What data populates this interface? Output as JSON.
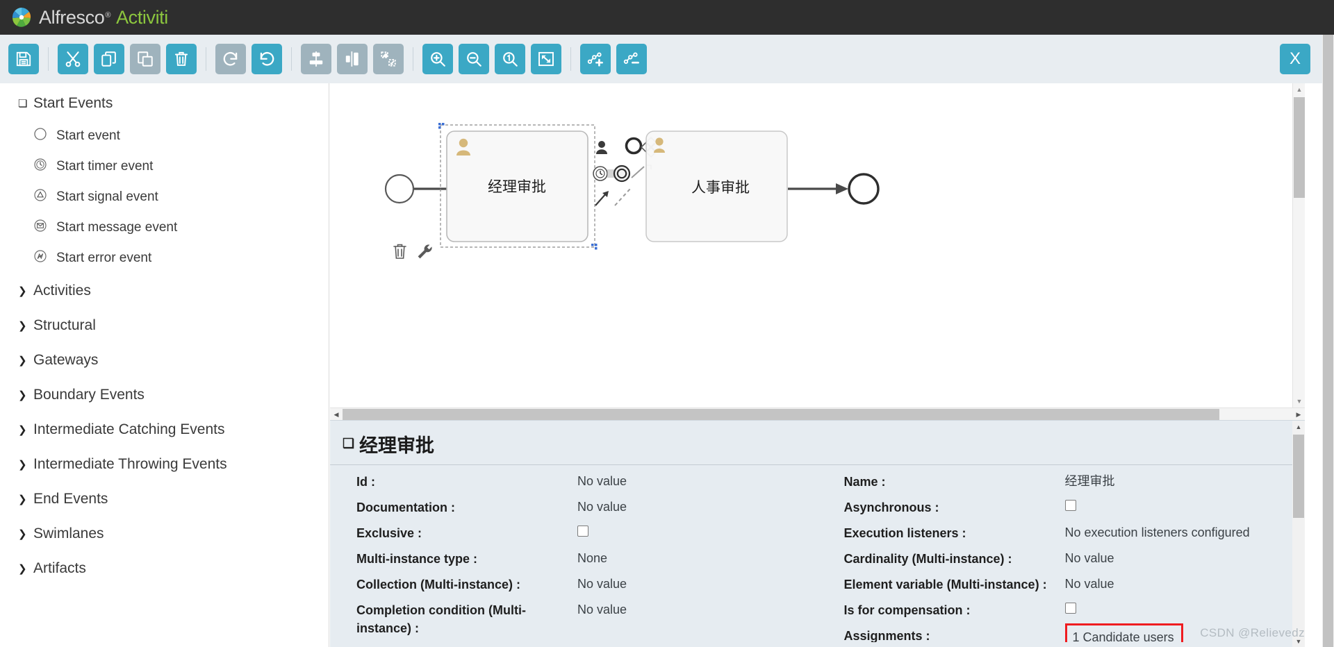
{
  "brand": {
    "primary": "Alfresco",
    "registered": "®",
    "secondary": "Activiti",
    "logo_icon": "alfresco-pinwheel-logo"
  },
  "colors": {
    "brand_dark": "#2e2e2e",
    "accent_green": "#8cc63e",
    "toolbar_active": "#3ba8c5",
    "toolbar_disabled": "#9fb3bd",
    "toolbar_bg": "#e8edf1",
    "panel_bg": "#e6ecf1",
    "highlight_red": "#ef1c20"
  },
  "toolbar": {
    "buttons": [
      {
        "name": "save-button",
        "icon": "floppy-disk-icon",
        "state": "enabled",
        "sep_after": true
      },
      {
        "name": "cut-button",
        "icon": "scissors-icon",
        "state": "enabled",
        "sep_after": false
      },
      {
        "name": "copy-button",
        "icon": "copy-icon",
        "state": "enabled",
        "sep_after": false
      },
      {
        "name": "paste-button",
        "icon": "paste-icon",
        "state": "disabled",
        "sep_after": false
      },
      {
        "name": "delete-button",
        "icon": "trash-icon",
        "state": "enabled",
        "sep_after": true
      },
      {
        "name": "redo-button",
        "icon": "redo-arrow-icon",
        "state": "disabled",
        "sep_after": false
      },
      {
        "name": "undo-button",
        "icon": "undo-arrow-icon",
        "state": "enabled",
        "sep_after": true
      },
      {
        "name": "align-vertical-button",
        "icon": "align-vertical-icon",
        "state": "disabled",
        "sep_after": false
      },
      {
        "name": "align-horizontal-button",
        "icon": "align-horizontal-icon",
        "state": "disabled",
        "sep_after": false
      },
      {
        "name": "same-size-button",
        "icon": "same-size-icon",
        "state": "disabled",
        "sep_after": true
      },
      {
        "name": "zoom-in-button",
        "icon": "zoom-in-icon",
        "state": "enabled",
        "sep_after": false
      },
      {
        "name": "zoom-out-button",
        "icon": "zoom-out-icon",
        "state": "enabled",
        "sep_after": false
      },
      {
        "name": "zoom-actual-button",
        "icon": "zoom-actual-size-icon",
        "state": "enabled",
        "sep_after": false
      },
      {
        "name": "zoom-fit-button",
        "icon": "zoom-fit-icon",
        "state": "enabled",
        "sep_after": true
      },
      {
        "name": "add-bendpoint-button",
        "icon": "add-bendpoint-icon",
        "state": "enabled",
        "sep_after": false
      },
      {
        "name": "remove-bendpoint-button",
        "icon": "remove-bendpoint-icon",
        "state": "enabled",
        "sep_after": false
      }
    ],
    "close_label": "X"
  },
  "palette": {
    "groups": [
      {
        "label": "Start Events",
        "expanded": true,
        "items": [
          {
            "label": "Start event",
            "icon": "empty-circle-icon"
          },
          {
            "label": "Start timer event",
            "icon": "timer-circle-icon"
          },
          {
            "label": "Start signal event",
            "icon": "signal-triangle-circle-icon"
          },
          {
            "label": "Start message event",
            "icon": "message-envelope-circle-icon"
          },
          {
            "label": "Start error event",
            "icon": "error-bolt-circle-icon"
          }
        ]
      },
      {
        "label": "Activities",
        "expanded": false,
        "items": []
      },
      {
        "label": "Structural",
        "expanded": false,
        "items": []
      },
      {
        "label": "Gateways",
        "expanded": false,
        "items": []
      },
      {
        "label": "Boundary Events",
        "expanded": false,
        "items": []
      },
      {
        "label": "Intermediate Catching Events",
        "expanded": false,
        "items": []
      },
      {
        "label": "Intermediate Throwing Events",
        "expanded": false,
        "items": []
      },
      {
        "label": "End Events",
        "expanded": false,
        "items": []
      },
      {
        "label": "Swimlanes",
        "expanded": false,
        "items": []
      },
      {
        "label": "Artifacts",
        "expanded": false,
        "items": []
      }
    ]
  },
  "canvas": {
    "nodes": [
      {
        "name": "start-event-node",
        "type": "start-event",
        "label": ""
      },
      {
        "name": "user-task-node-1",
        "type": "user-task",
        "label": "经理审批",
        "selected": true
      },
      {
        "name": "user-task-node-2",
        "type": "user-task",
        "label": "人事审批",
        "selected": false
      },
      {
        "name": "end-event-node",
        "type": "end-event",
        "label": ""
      }
    ],
    "selection_actions": [
      {
        "name": "delete-shape-button",
        "icon": "trash-icon"
      },
      {
        "name": "morph-shape-button",
        "icon": "wrench-icon"
      }
    ],
    "quick_menu": [
      {
        "name": "quick-user-task-button",
        "icon": "user-task-icon"
      },
      {
        "name": "quick-end-event-button",
        "icon": "end-event-circle-icon"
      },
      {
        "name": "quick-exclusive-gateway-button",
        "icon": "exclusive-gateway-icon"
      },
      {
        "name": "quick-boundary-timer-button",
        "icon": "boundary-timer-icon"
      },
      {
        "name": "quick-terminate-button",
        "icon": "terminate-end-icon"
      },
      {
        "name": "quick-sequence-flow-button",
        "icon": "sequence-flow-arrow-icon"
      },
      {
        "name": "quick-association-button",
        "icon": "association-line-icon"
      },
      {
        "name": "quick-text-annotation-button",
        "icon": "text-annotation-icon"
      }
    ]
  },
  "properties": {
    "title": "经理审批",
    "left_column": [
      {
        "label": "Id :",
        "value": "No value",
        "type": "text"
      },
      {
        "label": "Documentation :",
        "value": "No value",
        "type": "text"
      },
      {
        "label": "Exclusive :",
        "value": "",
        "type": "checkbox",
        "checked": false
      },
      {
        "label": "Multi-instance type :",
        "value": "None",
        "type": "text"
      },
      {
        "label": "Collection (Multi-instance) :",
        "value": "No value",
        "type": "text"
      },
      {
        "label": "Completion condition (Multi-instance) :",
        "value": "No value",
        "type": "text"
      }
    ],
    "right_column": [
      {
        "label": "Name :",
        "value": "经理审批",
        "type": "text"
      },
      {
        "label": "Asynchronous :",
        "value": "",
        "type": "checkbox",
        "checked": false
      },
      {
        "label": "Execution listeners :",
        "value": "No execution listeners configured",
        "type": "text"
      },
      {
        "label": "Cardinality (Multi-instance) :",
        "value": "No value",
        "type": "text"
      },
      {
        "label": "Element variable (Multi-instance) :",
        "value": "No value",
        "type": "text"
      },
      {
        "label": "Is for compensation :",
        "value": "",
        "type": "checkbox",
        "checked": false
      },
      {
        "label": "Assignments :",
        "value": "1 Candidate users",
        "type": "highlighted"
      }
    ]
  },
  "watermark": "CSDN @Relievedz"
}
